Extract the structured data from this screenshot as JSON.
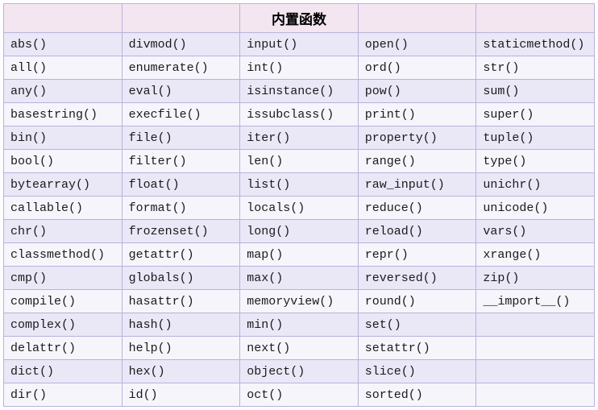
{
  "header": [
    "",
    "",
    "内置函数",
    "",
    ""
  ],
  "rows": [
    [
      "abs()",
      "divmod()",
      "input()",
      "open()",
      "staticmethod()"
    ],
    [
      "all()",
      "enumerate()",
      "int()",
      "ord()",
      "str()"
    ],
    [
      "any()",
      "eval()",
      "isinstance()",
      "pow()",
      "sum()"
    ],
    [
      "basestring()",
      "execfile()",
      "issubclass()",
      "print()",
      "super()"
    ],
    [
      "bin()",
      "file()",
      "iter()",
      "property()",
      "tuple()"
    ],
    [
      "bool()",
      "filter()",
      "len()",
      "range()",
      "type()"
    ],
    [
      "bytearray()",
      "float()",
      "list()",
      "raw_input()",
      "unichr()"
    ],
    [
      "callable()",
      "format()",
      "locals()",
      "reduce()",
      "unicode()"
    ],
    [
      "chr()",
      "frozenset()",
      "long()",
      "reload()",
      "vars()"
    ],
    [
      "classmethod()",
      "getattr()",
      "map()",
      "repr()",
      "xrange()"
    ],
    [
      "cmp()",
      "globals()",
      "max()",
      "reversed()",
      "zip()"
    ],
    [
      "compile()",
      "hasattr()",
      "memoryview()",
      "round()",
      "__import__()"
    ],
    [
      "complex()",
      "hash()",
      "min()",
      "set()",
      ""
    ],
    [
      "delattr()",
      "help()",
      "next()",
      "setattr()",
      ""
    ],
    [
      "dict()",
      "hex()",
      "object()",
      "slice()",
      ""
    ],
    [
      "dir()",
      "id()",
      "oct()",
      "sorted()",
      ""
    ]
  ]
}
